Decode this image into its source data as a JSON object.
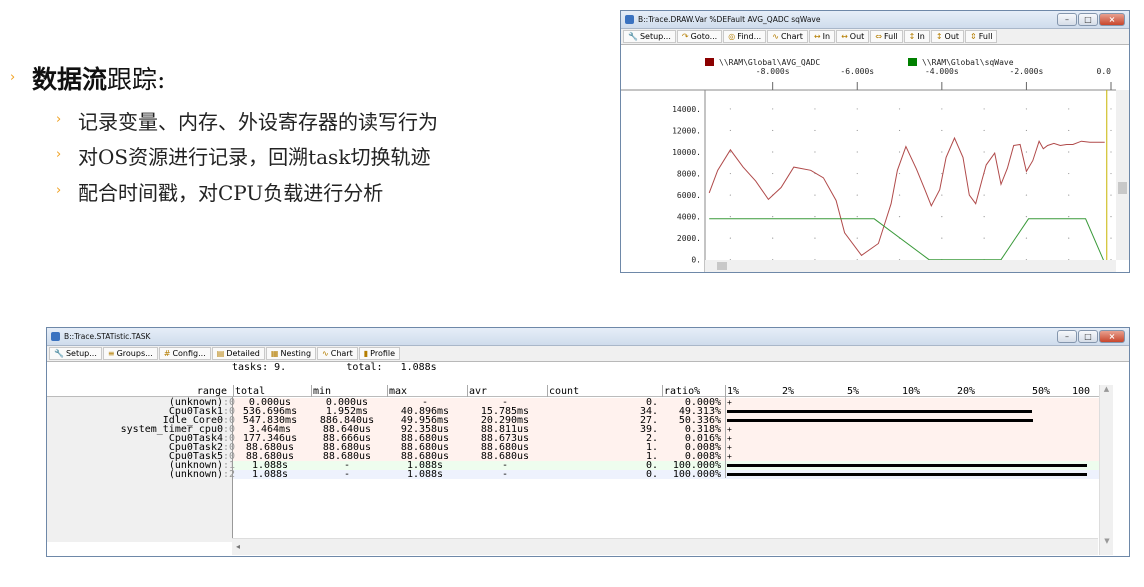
{
  "slide": {
    "bullet_glyph": "›",
    "title_bold": "数据流",
    "title_rest": "跟踪:",
    "points": [
      "记录变量、内存、外设寄存器的读写行为",
      "对OS资源进行记录，回溯task切换轨迹",
      "配合时间戳，对CPU负载进行分析"
    ]
  },
  "chart_window": {
    "title": "B::Trace.DRAW.Var %DEFault AVG_QADC sqWave",
    "toolbar": [
      {
        "label": "Setup...",
        "icon": "wrench-icon"
      },
      {
        "label": "Goto...",
        "icon": "goto-icon"
      },
      {
        "label": "Find...",
        "icon": "binoculars-icon"
      },
      {
        "label": "Chart",
        "icon": "chart-icon"
      },
      {
        "label": "In",
        "icon": "zoom-in-icon"
      },
      {
        "label": "Out",
        "icon": "zoom-out-icon"
      },
      {
        "label": "Full",
        "icon": "full-icon"
      },
      {
        "label": "In",
        "icon": "v-zoom-in-icon"
      },
      {
        "label": "Out",
        "icon": "v-zoom-out-icon"
      },
      {
        "label": "Full",
        "icon": "v-full-icon"
      }
    ],
    "legend": [
      {
        "name": "\\\\RAM\\Global\\AVG_QADC",
        "color": "#8b0000"
      },
      {
        "name": "\\\\RAM\\Global\\sqWave",
        "color": "#008000"
      }
    ],
    "time_ticks": [
      "-8.000s",
      "-6.000s",
      "-4.000s",
      "-2.000s",
      "0.0"
    ]
  },
  "chart_data": {
    "type": "line",
    "x_range": [
      -9.6,
      0
    ],
    "ylim": [
      -400,
      15200
    ],
    "y_ticks": [
      0,
      2000,
      4000,
      6000,
      8000,
      10000,
      12000,
      14000
    ],
    "y_tick_labels": [
      "0.",
      "2000.",
      "4000.",
      "6000.",
      "8000.",
      "10000.",
      "12000.",
      "14000."
    ],
    "series": [
      {
        "name": "\\\\RAM\\Global\\AVG_QADC",
        "color": "#b04a4a",
        "x": [
          -9.5,
          -9.3,
          -9.0,
          -8.7,
          -8.4,
          -8.1,
          -7.8,
          -7.5,
          -7.1,
          -6.8,
          -6.5,
          -6.3,
          -5.9,
          -5.5,
          -5.2,
          -5.05,
          -4.85,
          -4.6,
          -4.4,
          -4.25,
          -4.05,
          -3.9,
          -3.7,
          -3.5,
          -3.35,
          -3.2,
          -3.05,
          -2.95,
          -2.75,
          -2.6,
          -2.45,
          -2.3,
          -2.15,
          -2.0,
          -1.85,
          -1.7,
          -1.6,
          -1.5,
          -1.35,
          -1.2,
          -1.05,
          -0.9,
          -0.7,
          -0.5,
          -0.3,
          -0.15
        ],
        "y": [
          6200,
          8300,
          10200,
          8600,
          7300,
          5600,
          6700,
          8600,
          8300,
          7600,
          5500,
          2500,
          400,
          1500,
          5200,
          8300,
          10500,
          8400,
          6500,
          5000,
          6500,
          9500,
          11300,
          9500,
          6000,
          5200,
          7400,
          8800,
          9900,
          7000,
          8500,
          10600,
          10700,
          8200,
          9200,
          11000,
          10300,
          10600,
          10800,
          10600,
          10700,
          10700,
          11000,
          10900,
          10900,
          10900
        ]
      },
      {
        "name": "\\\\RAM\\Global\\sqWave",
        "color": "#3a9a3a",
        "x": [
          -9.5,
          -6.6,
          -5.6,
          -4.3,
          -2.6,
          -1.95,
          -0.6,
          -0.15
        ],
        "y": [
          3800,
          3800,
          3800,
          0,
          0,
          3800,
          3800,
          -300
        ]
      }
    ]
  },
  "task_window": {
    "title": "B::Trace.STATistic.TASK",
    "toolbar": [
      {
        "label": "Setup...",
        "icon": "wrench-icon"
      },
      {
        "label": "Groups...",
        "icon": "groups-icon"
      },
      {
        "label": "Config...",
        "icon": "config-icon"
      },
      {
        "label": "Detailed",
        "icon": "detailed-icon"
      },
      {
        "label": "Nesting",
        "icon": "nesting-icon"
      },
      {
        "label": "Chart",
        "icon": "chart-icon"
      },
      {
        "label": "Profile",
        "icon": "profile-icon"
      }
    ],
    "summary_line": "tasks: 9.          total:   1.088s",
    "headers": [
      "range",
      "total",
      "min",
      "max",
      "avr",
      "count",
      "ratio%"
    ],
    "scale_ticks": [
      "1%",
      "2%",
      "5%",
      "10%",
      "20%",
      "50%",
      "100"
    ],
    "rows": [
      {
        "name": "(unknown)",
        "idx": ":0",
        "total": "0.000us",
        "min": "0.000us",
        "max": "-",
        "avr": "-",
        "count": "0.",
        "ratio": "0.000%",
        "bar": 0,
        "color": "#fff2ee"
      },
      {
        "name": "Cpu0Task1",
        "idx": ":0",
        "total": "536.696ms",
        "min": "1.952ms",
        "max": "40.896ms",
        "avr": "15.785ms",
        "count": "34.",
        "ratio": "49.313%",
        "bar": 0.4931,
        "color": "#fff2ee"
      },
      {
        "name": "Idle_Core0",
        "idx": ":0",
        "total": "547.830ms",
        "min": "886.840us",
        "max": "49.956ms",
        "avr": "20.290ms",
        "count": "27.",
        "ratio": "50.336%",
        "bar": 0.5034,
        "color": "#fff2ee"
      },
      {
        "name": "system_timer_cpu0",
        "idx": ":0",
        "total": "3.464ms",
        "min": "88.640us",
        "max": "92.358us",
        "avr": "88.811us",
        "count": "39.",
        "ratio": "0.318%",
        "bar": 0.0032,
        "color": "#fff2ee"
      },
      {
        "name": "Cpu0Task4",
        "idx": ":0",
        "total": "177.346us",
        "min": "88.666us",
        "max": "88.680us",
        "avr": "88.673us",
        "count": "2.",
        "ratio": "0.016%",
        "bar": 0.0002,
        "color": "#fff2ee"
      },
      {
        "name": "Cpu0Task2",
        "idx": ":0",
        "total": "88.680us",
        "min": "88.680us",
        "max": "88.680us",
        "avr": "88.680us",
        "count": "1.",
        "ratio": "0.008%",
        "bar": 0.0001,
        "color": "#fff2ee"
      },
      {
        "name": "Cpu0Task5",
        "idx": ":0",
        "total": "88.680us",
        "min": "88.680us",
        "max": "88.680us",
        "avr": "88.680us",
        "count": "1.",
        "ratio": "0.008%",
        "bar": 0.0001,
        "color": "#fff2ee"
      },
      {
        "name": "(unknown)",
        "idx": ":1",
        "total": "1.088s",
        "min": "-",
        "max": "1.088s",
        "avr": "-",
        "count": "0.",
        "ratio": "100.000%",
        "bar": 1,
        "color": "#eefdee"
      },
      {
        "name": "(unknown)",
        "idx": ":2",
        "total": "1.088s",
        "min": "-",
        "max": "1.088s",
        "avr": "-",
        "count": "0.",
        "ratio": "100.000%",
        "bar": 1,
        "color": "#eef2fd"
      }
    ]
  }
}
